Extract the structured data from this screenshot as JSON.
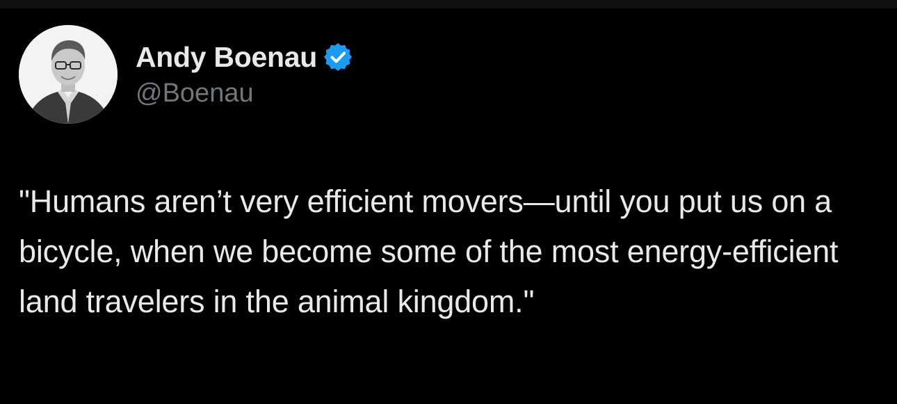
{
  "tweet": {
    "author": {
      "display_name": "Andy Boenau",
      "handle": "@Boenau",
      "verified": true,
      "avatar_icon": "profile-photo-man-in-blazer"
    },
    "text": "\"Humans aren’t very efficient movers—until you put us on a bicycle, when we become some of the most energy-efficient land travelers in the animal kingdom.\""
  },
  "colors": {
    "background": "#000000",
    "primary_text": "#e7e9ea",
    "secondary_text": "#71767b",
    "verified_blue": "#1d9bf0"
  }
}
